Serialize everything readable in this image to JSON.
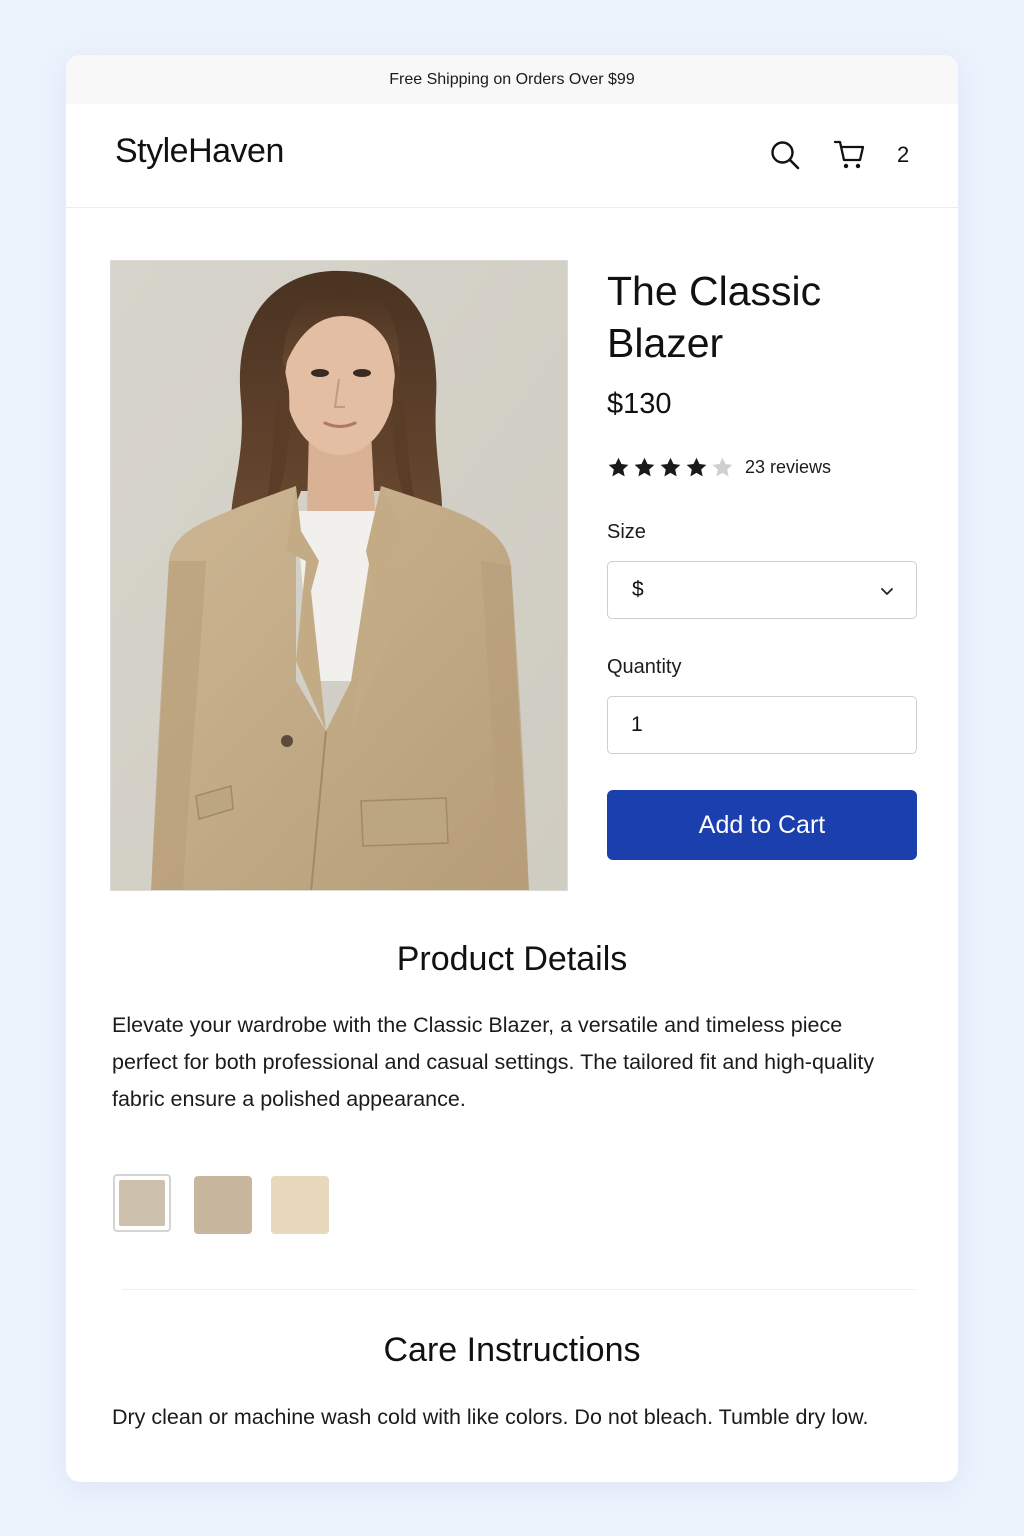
{
  "announcement": "Free Shipping on Orders Over $99",
  "header": {
    "logo": "StyleHaven",
    "search_icon": "search-icon",
    "cart_icon": "cart-icon",
    "cart_count": "2"
  },
  "product": {
    "image": "Woman wearing a beige tailored blazer over a white top",
    "title": "The Classic Blazer",
    "price": "$130",
    "rating": 4,
    "rating_max": 5,
    "reviews": "23 reviews",
    "size_label": "Size",
    "size_value": "$",
    "quantity_label": "Quantity",
    "quantity_value": "1",
    "add_to_cart_label": "Add to Cart"
  },
  "details": {
    "title": "Product Details",
    "description": "Elevate your wardrobe with the Classic Blazer, a versatile and timeless piece perfect for both professional and casual settings. The tailored fit and high-quality fabric ensure a polished appearance."
  },
  "swatches": [
    {
      "color": "#cdc1ad",
      "selected": true
    },
    {
      "color": "#c8b79e",
      "selected": false
    },
    {
      "color": "#e8d9bc",
      "selected": false
    }
  ],
  "care": {
    "title": "Care Instructions",
    "text": "Dry clean or machine wash cold with like colors. Do not bleach. Tumble dry low."
  },
  "colors": {
    "accent": "#1b3fac",
    "page_background": "#edf3fd",
    "star_filled": "#1a1a1a",
    "star_empty": "#d0d0d0"
  }
}
